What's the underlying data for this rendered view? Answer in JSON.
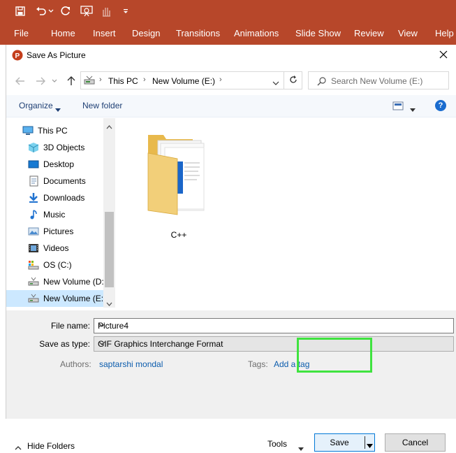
{
  "ribbon": {
    "bg_color": "#b7472a",
    "qat_icons": [
      "save-icon",
      "undo-icon",
      "undo-dropdown-icon",
      "redo-icon",
      "present-from-start-icon",
      "touch-mode-icon",
      "customize-qat-icon"
    ],
    "menu": [
      "File",
      "Home",
      "Insert",
      "Design",
      "Transitions",
      "Animations",
      "Slide Show",
      "Review",
      "View",
      "Help"
    ]
  },
  "dialog": {
    "title": "Save As Picture",
    "address": {
      "crumbs": [
        "This PC",
        "New Volume (E:)"
      ]
    },
    "search": {
      "placeholder": "Search New Volume (E:)"
    },
    "toolbar": {
      "organize": "Organize",
      "new_folder": "New folder",
      "help": "?"
    },
    "nav": {
      "items": [
        {
          "label": "This PC",
          "icon": "computer-icon"
        },
        {
          "label": "3D Objects",
          "icon": "3d-objects-icon"
        },
        {
          "label": "Desktop",
          "icon": "desktop-icon"
        },
        {
          "label": "Documents",
          "icon": "documents-icon"
        },
        {
          "label": "Downloads",
          "icon": "downloads-icon"
        },
        {
          "label": "Music",
          "icon": "music-icon"
        },
        {
          "label": "Pictures",
          "icon": "pictures-icon"
        },
        {
          "label": "Videos",
          "icon": "videos-icon"
        },
        {
          "label": "OS (C:)",
          "icon": "os-drive-icon"
        },
        {
          "label": "New Volume (D:",
          "icon": "drive-icon"
        },
        {
          "label": "New Volume (E:)",
          "icon": "drive-icon",
          "selected": true
        }
      ]
    },
    "files": [
      {
        "name": "C++",
        "type": "folder"
      }
    ],
    "form": {
      "file_name_label": "File name:",
      "file_name_value": "Picture4",
      "save_type_label": "Save as type:",
      "save_type_value": "GIF Graphics Interchange Format",
      "authors_label": "Authors:",
      "authors_value": "saptarshi mondal",
      "tags_label": "Tags:",
      "tags_value": "Add a tag"
    },
    "footer": {
      "hide_folders": "Hide Folders",
      "tools": "Tools",
      "save": "Save",
      "cancel": "Cancel"
    },
    "highlight_color": "#3fe33f"
  }
}
